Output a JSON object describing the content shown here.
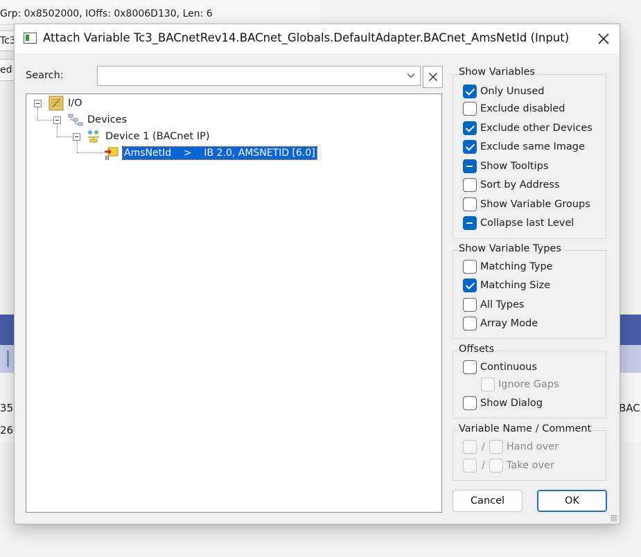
{
  "background": {
    "info_text": "Grp: 0x8502000, IOffs: 0x8006D130, Len: 6",
    "tab1": "Tc3",
    "tab2": "ed",
    "row1_left": "35",
    "row2_left": "26",
    "row1_right": "BAC"
  },
  "dialog": {
    "title": "Attach Variable Tc3_BACnetRev14.BACnet_Globals.DefaultAdapter.BACnet_AmsNetId (Input)",
    "close_icon": "close-icon",
    "search": {
      "label": "Search:",
      "value": "",
      "placeholder": ""
    },
    "tree": [
      {
        "label": "I/O",
        "icon": "io-folder-icon",
        "expanded": true
      },
      {
        "label": "Devices",
        "icon": "devices-icon",
        "expanded": true
      },
      {
        "label": "Device 1 (BACnet IP)",
        "icon": "device-icon",
        "expanded": true
      },
      {
        "label": "AmsNetId    >    IB 2.0, AMSNETID [6.0]",
        "icon": "input-variable-icon",
        "selected": true
      }
    ],
    "show_variables": {
      "title": "Show Variables",
      "items": [
        {
          "label": "Only Unused",
          "state": "checked"
        },
        {
          "label": "Exclude disabled",
          "state": "unchecked"
        },
        {
          "label": "Exclude other Devices",
          "state": "checked"
        },
        {
          "label": "Exclude same Image",
          "state": "checked"
        },
        {
          "label": "Show Tooltips",
          "state": "indeterminate"
        },
        {
          "label": "Sort by Address",
          "state": "unchecked"
        },
        {
          "label": "Show Variable Groups",
          "state": "unchecked"
        },
        {
          "label": "Collapse last Level",
          "state": "indeterminate"
        }
      ]
    },
    "show_variable_types": {
      "title": "Show Variable Types",
      "items": [
        {
          "label": "Matching Type",
          "state": "unchecked"
        },
        {
          "label": "Matching Size",
          "state": "checked"
        },
        {
          "label": "All Types",
          "state": "unchecked"
        },
        {
          "label": "Array Mode",
          "state": "unchecked"
        }
      ]
    },
    "offsets": {
      "title": "Offsets",
      "continuous": "Continuous",
      "ignore_gaps": "Ignore Gaps",
      "show_dialog": "Show Dialog"
    },
    "variable_name": {
      "title": "Variable Name / Comment",
      "separator": "/",
      "hand_over": "Hand over",
      "take_over": "Take over"
    },
    "buttons": {
      "cancel": "Cancel",
      "ok": "OK"
    },
    "colors": {
      "accent": "#0067c0",
      "selection": "#0a64d6"
    }
  }
}
